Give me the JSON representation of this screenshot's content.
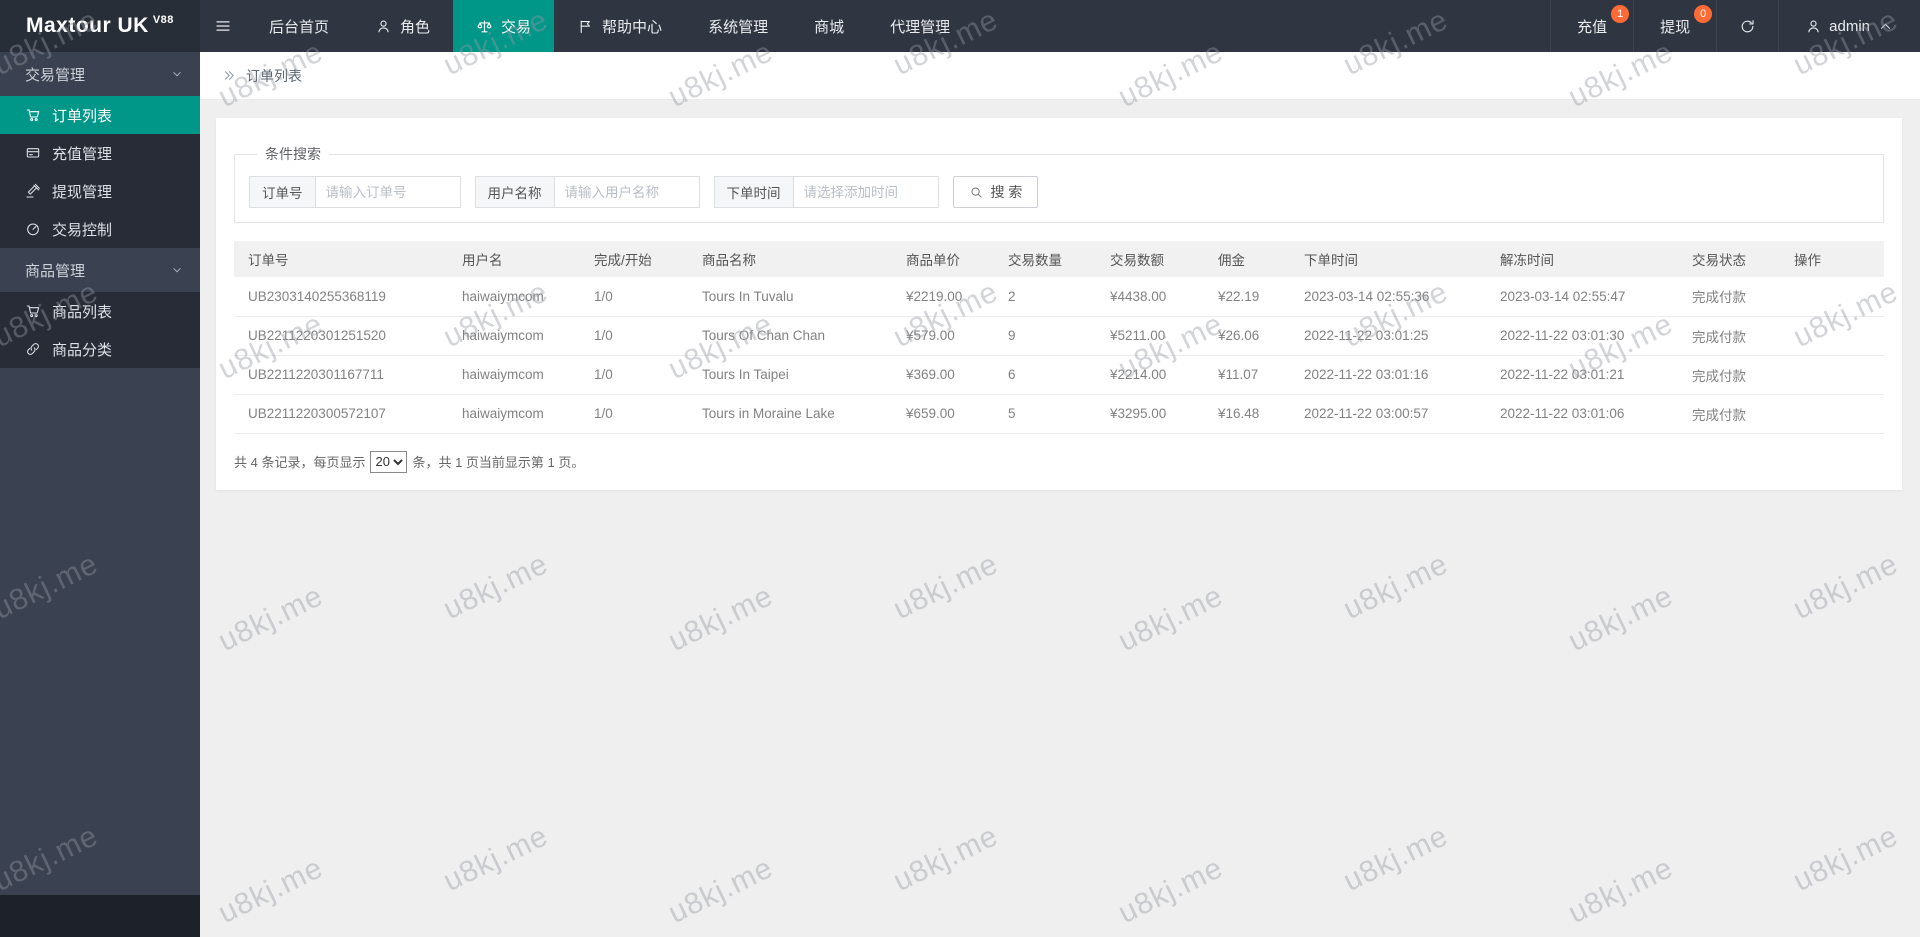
{
  "topbar": {
    "logo": "Maxtour UK",
    "logo_sup": "V88",
    "nav": [
      {
        "label": "后台首页",
        "icon": null,
        "active": false
      },
      {
        "label": "角色",
        "icon": "person",
        "active": false
      },
      {
        "label": "交易",
        "icon": "scales",
        "active": true
      },
      {
        "label": "帮助中心",
        "icon": "flag",
        "active": false
      },
      {
        "label": "系统管理",
        "icon": null,
        "active": false
      },
      {
        "label": "商城",
        "icon": null,
        "active": false
      },
      {
        "label": "代理管理",
        "icon": null,
        "active": false
      }
    ],
    "recharge": {
      "label": "充值",
      "badge": "1"
    },
    "withdraw": {
      "label": "提现",
      "badge": "0"
    },
    "user": "admin"
  },
  "sidebar": {
    "groups": [
      {
        "label": "交易管理",
        "items": [
          {
            "label": "订单列表",
            "icon": "cart",
            "active": true
          },
          {
            "label": "充值管理",
            "icon": "card",
            "active": false
          },
          {
            "label": "提现管理",
            "icon": "gavel",
            "active": false
          },
          {
            "label": "交易控制",
            "icon": "gauge",
            "active": false
          }
        ]
      },
      {
        "label": "商品管理",
        "items": [
          {
            "label": "商品列表",
            "icon": "cart",
            "active": false
          },
          {
            "label": "商品分类",
            "icon": "link",
            "active": false
          }
        ]
      }
    ]
  },
  "breadcrumb": "订单列表",
  "search": {
    "legend": "条件搜索",
    "fields": [
      {
        "label": "订单号",
        "placeholder": "请输入订单号"
      },
      {
        "label": "用户名称",
        "placeholder": "请输入用户名称"
      },
      {
        "label": "下单时间",
        "placeholder": "请选择添加时间"
      }
    ],
    "button": "搜 索"
  },
  "table": {
    "headers": [
      "订单号",
      "用户名",
      "完成/开始",
      "商品名称",
      "商品单价",
      "交易数量",
      "交易数额",
      "佣金",
      "下单时间",
      "解冻时间",
      "交易状态",
      "操作"
    ],
    "rows": [
      [
        "UB2303140255368119",
        "haiwaiymcom",
        "1/0",
        "Tours In Tuvalu",
        "¥2219.00",
        "2",
        "¥4438.00",
        "¥22.19",
        "2023-03-14 02:55:36",
        "2023-03-14 02:55:47",
        "完成付款",
        ""
      ],
      [
        "UB2211220301251520",
        "haiwaiymcom",
        "1/0",
        "Tours Of Chan Chan",
        "¥579.00",
        "9",
        "¥5211.00",
        "¥26.06",
        "2022-11-22 03:01:25",
        "2022-11-22 03:01:30",
        "完成付款",
        ""
      ],
      [
        "UB2211220301167711",
        "haiwaiymcom",
        "1/0",
        "Tours In Taipei",
        "¥369.00",
        "6",
        "¥2214.00",
        "¥11.07",
        "2022-11-22 03:01:16",
        "2022-11-22 03:01:21",
        "完成付款",
        ""
      ],
      [
        "UB2211220300572107",
        "haiwaiymcom",
        "1/0",
        "Tours in Moraine Lake",
        "¥659.00",
        "5",
        "¥3295.00",
        "¥16.48",
        "2022-11-22 03:00:57",
        "2022-11-22 03:01:06",
        "完成付款",
        ""
      ]
    ]
  },
  "pagination": {
    "prefix": "共 4 条记录，每页显示",
    "per_page": "20",
    "suffix": "条，共 1 页当前显示第 1 页。"
  },
  "watermark": "u8kj.me",
  "colors": {
    "accent": "#009688",
    "badge": "#ff6a35"
  }
}
